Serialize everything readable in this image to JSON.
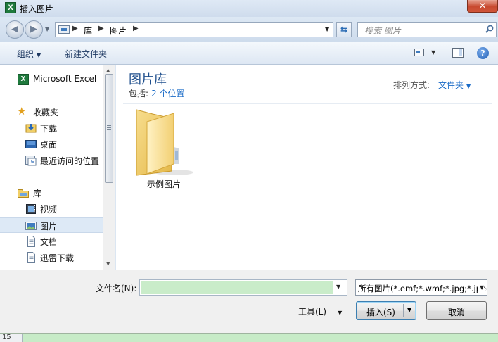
{
  "window": {
    "title": "插入图片",
    "app_icon_letter": "X",
    "close_glyph": "✕"
  },
  "nav": {
    "back_glyph": "◀",
    "forward_glyph": "▶",
    "history_glyph": "▼",
    "breadcrumbs": [
      "库",
      "图片"
    ],
    "separator_glyph": "▶",
    "dropdown_glyph": "▼",
    "refresh_glyph": "⇆",
    "search_placeholder": "搜索 图片"
  },
  "toolbar": {
    "organize": "组织",
    "new_folder": "新建文件夹",
    "caret": "▼",
    "help_glyph": "?"
  },
  "navpane": {
    "items": [
      {
        "label": "Microsoft Excel",
        "icon": "excel-icon"
      },
      {
        "label": "收藏夹",
        "icon": "star-icon"
      },
      {
        "label": "下载",
        "icon": "download-icon"
      },
      {
        "label": "桌面",
        "icon": "desktop-icon"
      },
      {
        "label": "最近访问的位置",
        "icon": "recent-places-icon"
      },
      {
        "label": "库",
        "icon": "libraries-icon"
      },
      {
        "label": "视频",
        "icon": "video-icon"
      },
      {
        "label": "图片",
        "icon": "pictures-icon",
        "selected": true
      },
      {
        "label": "文档",
        "icon": "documents-icon"
      },
      {
        "label": "迅雷下载",
        "icon": "xunlei-icon"
      }
    ],
    "scroll_up_glyph": "▲",
    "scroll_down_glyph": "▼"
  },
  "content": {
    "library_title": "图片库",
    "subtitle_prefix": "包括:",
    "subtitle_link": "2 个位置",
    "arrange_label": "排列方式:",
    "arrange_value": "文件夹",
    "arrange_caret": "▼",
    "items": [
      {
        "name": "示例图片",
        "icon": "folder-icon"
      }
    ]
  },
  "bottom": {
    "filename_label": "文件名(N):",
    "filename_value": "",
    "filter_value": "所有图片(*.emf;*.wmf;*.jpg;*.jpeg;*.jfif;*.png;*.bmp;*.gif)",
    "tools_label": "工具(L)",
    "insert_label": "插入(S)",
    "cancel_label": "取消",
    "caret": "▼"
  },
  "sheet": {
    "row_number": "15"
  },
  "colors": {
    "accent_blue": "#1a6bc7",
    "library_title": "#1e4e8c",
    "selection": "#dde9f6",
    "filename_fill": "#c9ecc9"
  }
}
